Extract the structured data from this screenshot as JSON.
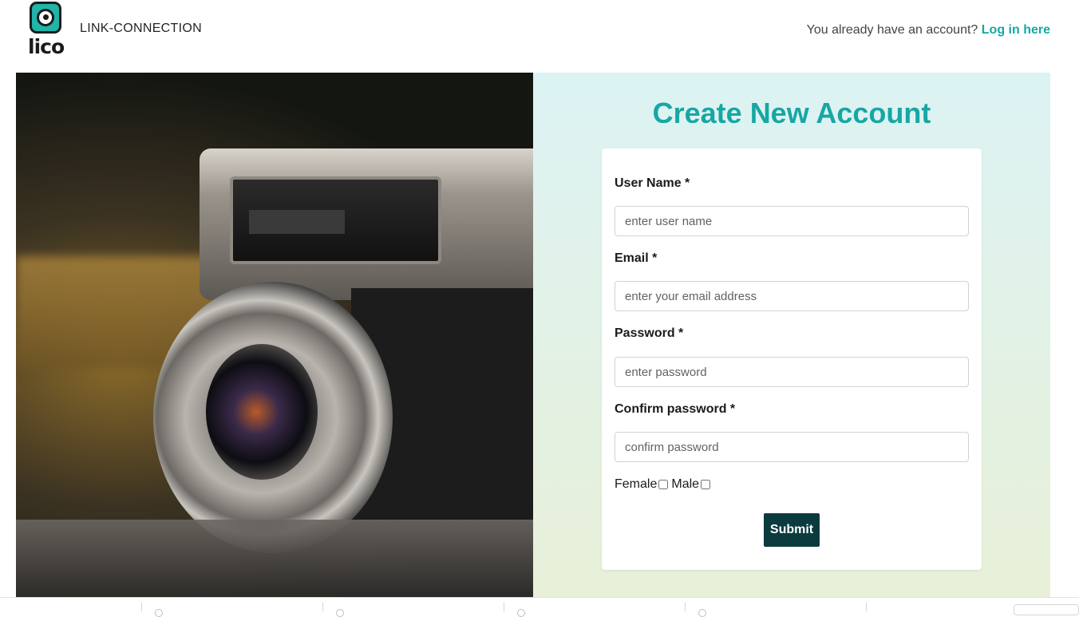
{
  "header": {
    "logo_text": "lico",
    "brand_name": "LINK-CONNECTION",
    "login_prompt": "You already have an account?",
    "login_link": "Log in here"
  },
  "hero": {
    "image_alt": "Vintage camera photo"
  },
  "form": {
    "title": "Create New Account",
    "fields": {
      "username": {
        "label": "User Name *",
        "placeholder": "enter user name"
      },
      "email": {
        "label": "Email *",
        "placeholder": "enter your email address"
      },
      "password": {
        "label": "Password *",
        "placeholder": "enter password"
      },
      "confirm": {
        "label": "Confirm password *",
        "placeholder": "confirm password"
      }
    },
    "gender": {
      "female_label": "Female",
      "male_label": "Male"
    },
    "submit_label": "Submit"
  },
  "colors": {
    "accent": "#17a7a4",
    "submit_bg": "#0b3b3f",
    "panel_top": "#dcf3f4",
    "panel_bottom": "#e8f0d8"
  },
  "icons": {
    "logo": "camera-lens-logo-icon"
  }
}
